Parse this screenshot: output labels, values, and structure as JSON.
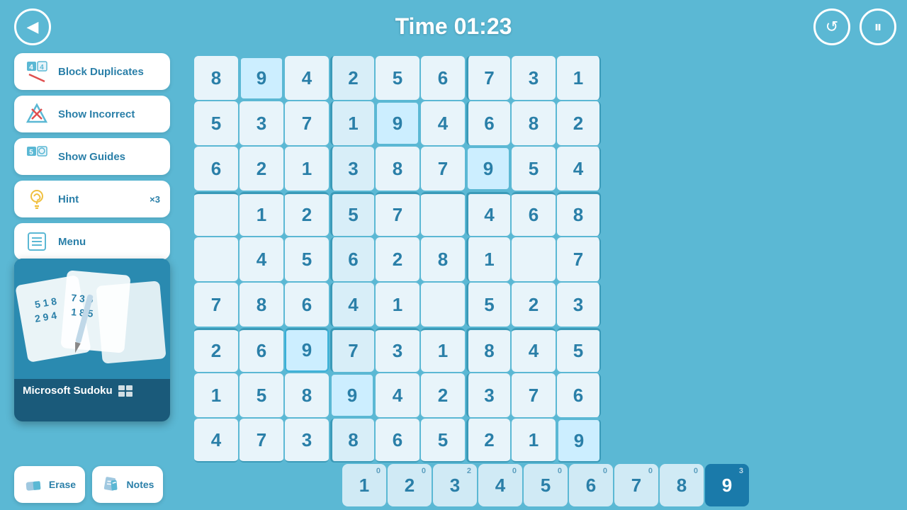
{
  "header": {
    "timer": "Time 01:23",
    "back_label": "◀",
    "undo_label": "↺",
    "pause_label": "⏸"
  },
  "sidebar": {
    "items": [
      {
        "id": "block-duplicates",
        "label": "Block Duplicates",
        "icon": "🔢"
      },
      {
        "id": "show-incorrect",
        "label": "Show Incorrect",
        "icon": "✗"
      },
      {
        "id": "show-guides",
        "label": "Show Guides",
        "icon": "🔷"
      },
      {
        "id": "hint",
        "label": "Hint",
        "icon": "💡",
        "extra": "×3"
      },
      {
        "id": "menu",
        "label": "Menu",
        "icon": "📋"
      }
    ]
  },
  "preview": {
    "title": "Microsoft Sudoku"
  },
  "grid": {
    "cells": [
      [
        8,
        9,
        4,
        2,
        5,
        6,
        7,
        3,
        1
      ],
      [
        5,
        3,
        7,
        1,
        9,
        4,
        6,
        8,
        2
      ],
      [
        6,
        2,
        1,
        3,
        8,
        7,
        9,
        5,
        4
      ],
      [
        0,
        1,
        2,
        5,
        7,
        0,
        4,
        6,
        8
      ],
      [
        0,
        4,
        5,
        6,
        2,
        8,
        1,
        0,
        7
      ],
      [
        7,
        8,
        6,
        4,
        1,
        0,
        5,
        2,
        3
      ],
      [
        2,
        6,
        9,
        7,
        3,
        1,
        8,
        4,
        5
      ],
      [
        1,
        5,
        8,
        9,
        4,
        2,
        3,
        7,
        6
      ],
      [
        4,
        7,
        3,
        8,
        6,
        5,
        2,
        1,
        9
      ]
    ],
    "highlighted": [
      [
        0,
        1
      ],
      [
        1,
        4
      ],
      [
        2,
        6
      ],
      [
        6,
        2
      ],
      [
        7,
        3
      ],
      [
        0,
        0
      ]
    ],
    "selected_col": 3
  },
  "numbers": [
    {
      "n": 1,
      "count": 0
    },
    {
      "n": 2,
      "count": 0
    },
    {
      "n": 3,
      "count": 2
    },
    {
      "n": 4,
      "count": 0
    },
    {
      "n": 5,
      "count": 0
    },
    {
      "n": 6,
      "count": 0
    },
    {
      "n": 7,
      "count": 0
    },
    {
      "n": 8,
      "count": 0
    },
    {
      "n": 9,
      "count": 3,
      "active": true
    }
  ],
  "tools": {
    "erase_label": "Erase",
    "notes_label": "Notes"
  }
}
